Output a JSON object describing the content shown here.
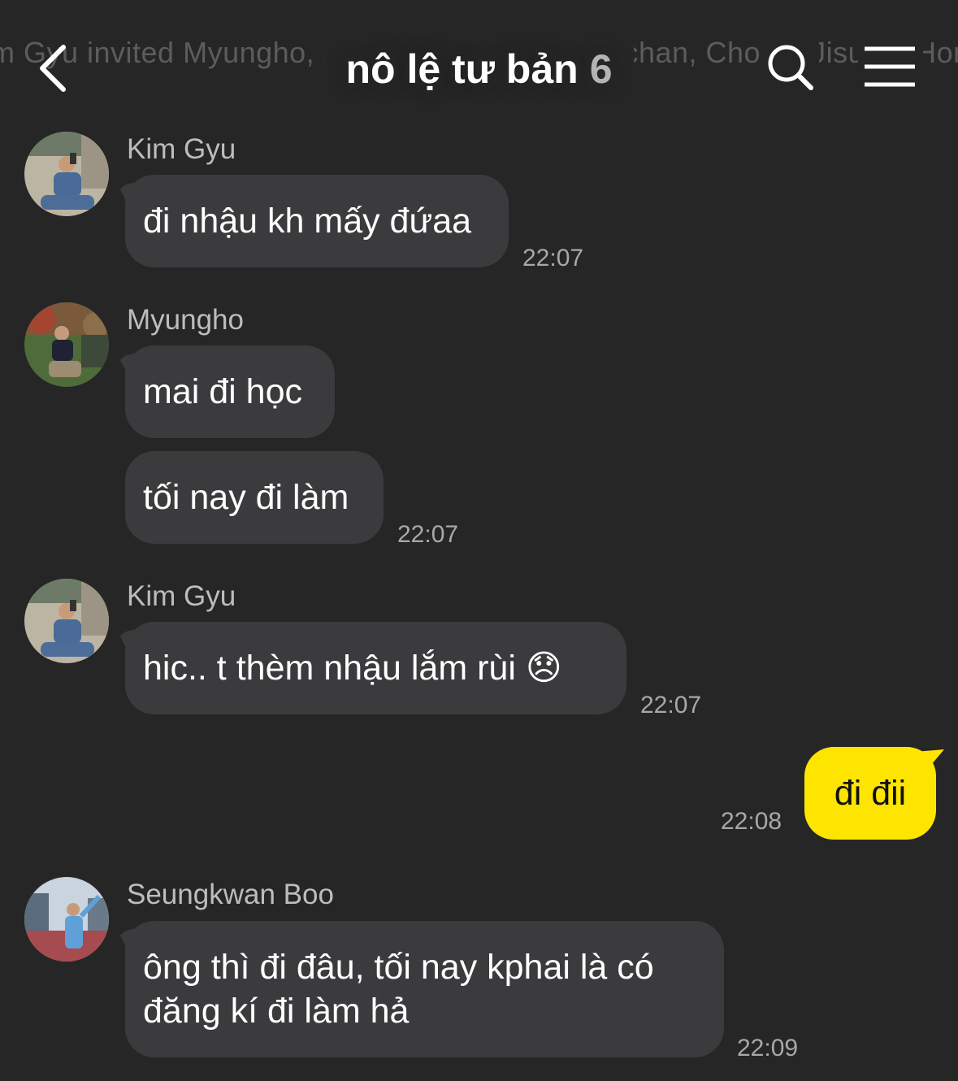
{
  "header": {
    "ticker": "m Gyu invited Myungho, Seungkwan Boo, Jungchan, Chong, Jisung, Hon",
    "title": "nô lệ tư bản",
    "member_count": "6",
    "back_icon": "chevron-left-icon",
    "search_icon": "search-icon",
    "menu_icon": "hamburger-menu-icon"
  },
  "colors": {
    "background": "#262626",
    "bubble_other": "#3b3b3d",
    "bubble_mine": "#fee500",
    "timestamp": "#a8a8a8"
  },
  "messages": [
    {
      "sender": "Kim Gyu",
      "texts": [
        "đi nhậu kh mấy đứaa"
      ],
      "time": "22:07"
    },
    {
      "sender": "Myungho",
      "texts": [
        "mai đi học",
        "tối nay đi làm"
      ],
      "time": "22:07"
    },
    {
      "sender": "Kim Gyu",
      "texts": [
        "hic.. t thèm nhậu lắm rùi 😞"
      ],
      "time": "22:07"
    },
    {
      "sender": "me",
      "texts": [
        "đi đii"
      ],
      "time": "22:08"
    },
    {
      "sender": "Seungkwan Boo",
      "texts": [
        "ông thì đi đâu, tối nay kphai là có",
        "đăng kí đi làm hả"
      ],
      "time": "22:09"
    }
  ]
}
